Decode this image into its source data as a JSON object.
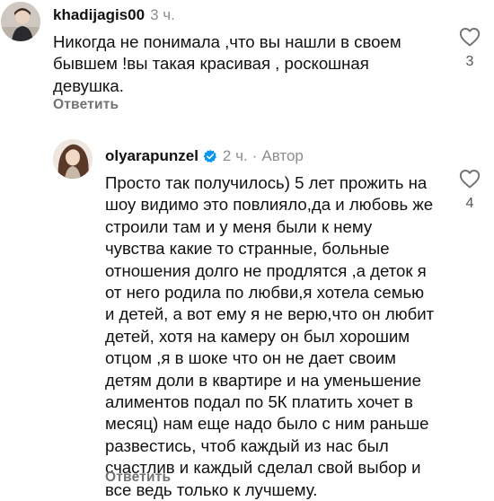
{
  "comments": [
    {
      "username": "khadijagis00",
      "time": "3 ч.",
      "text_lines": [
        "Никогда не понимала ,что вы нашли в своем",
        "бывшем !вы такая красивая , роскошная",
        "девушка."
      ],
      "reply_label": "Ответить",
      "likes": "3",
      "avatar_icon": "avatar-photo"
    },
    {
      "username": "olyarapunzel",
      "verified": true,
      "time": "2 ч.",
      "separator": "·",
      "author_label": "Автор",
      "text_lines": [
        "Просто так получилось) 5 лет прожить на",
        "шоу видимо это повлияло,да и любовь же",
        "строили там и у меня были к нему",
        "чувства какие то странные, больные",
        "отношения долго не продлятся ,а деток я",
        "от него родила по любви,я хотела семью",
        "и детей, а вот ему я не верю,что он любит",
        "детей, хотя на камеру он был хорошим",
        "отцом ,я в шоке что он не дает своим",
        "детям доли в квартире и на уменьшение",
        "алиментов подал по 5К платить хочет в",
        "месяц) нам еще надо было с ним раньше",
        "развестись, чтоб каждый из нас был",
        "счастлив и каждый сделал свой выбор и",
        "все ведь только к лучшему."
      ],
      "reply_label": "Ответить",
      "likes": "4",
      "avatar_icon": "avatar-photo"
    }
  ],
  "icons": {
    "like": "heart-outline-icon",
    "verified": "verified-badge-icon"
  },
  "colors": {
    "text": "#111111",
    "muted": "#8e8e8e",
    "verified_blue": "#0095f6"
  }
}
